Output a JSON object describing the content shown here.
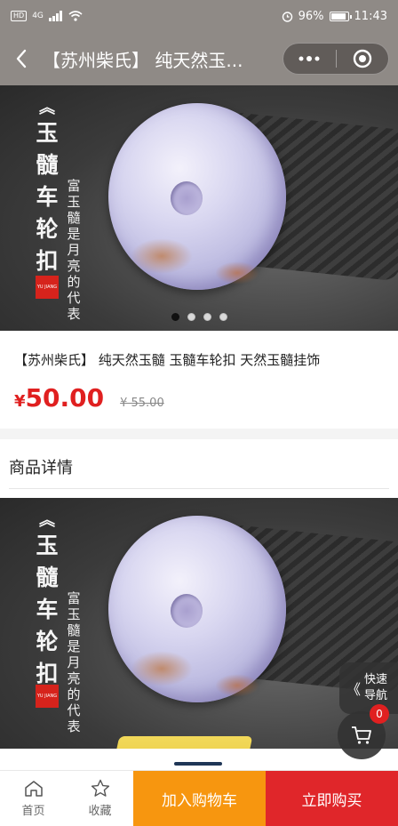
{
  "status_bar": {
    "left_badges": [
      "HD",
      "4G"
    ],
    "battery": "96%",
    "battery_level": 0.96,
    "time": "11:43",
    "icons": [
      "signal-icon",
      "wifi-icon",
      "alarm-icon",
      "battery-icon"
    ]
  },
  "nav": {
    "title": "【苏州柴氏】 纯天然玉...",
    "icons": [
      "back-arrow-icon",
      "more-dots-icon",
      "close-target-icon"
    ]
  },
  "hero": {
    "vertical_title": [
      "玉",
      "髓",
      "车",
      "轮",
      "扣"
    ],
    "vertical_subtitle": "富玉髓是月亮的代表",
    "seal_text": "YU JIANG",
    "carousel_count": 4,
    "carousel_active": 0
  },
  "product": {
    "name": "【苏州柴氏】 纯天然玉髓 玉髓车轮扣 天然玉髓挂饰",
    "price_symbol": "¥",
    "price": "50.00",
    "original_price": "¥ 55.00"
  },
  "detail": {
    "title": "商品详情"
  },
  "floating": {
    "quick_nav_arrow": "《",
    "quick_nav_label": "快速导航",
    "cart_badge": "0"
  },
  "bottom_bar": {
    "home_label": "首页",
    "favorite_label": "收藏",
    "add_to_cart_label": "加入购物车",
    "buy_now_label": "立即购买"
  },
  "colors": {
    "header_bg": "#8f8a86",
    "price_red": "#e02020",
    "cart_orange": "#f7960f",
    "buy_red": "#e0262a"
  }
}
